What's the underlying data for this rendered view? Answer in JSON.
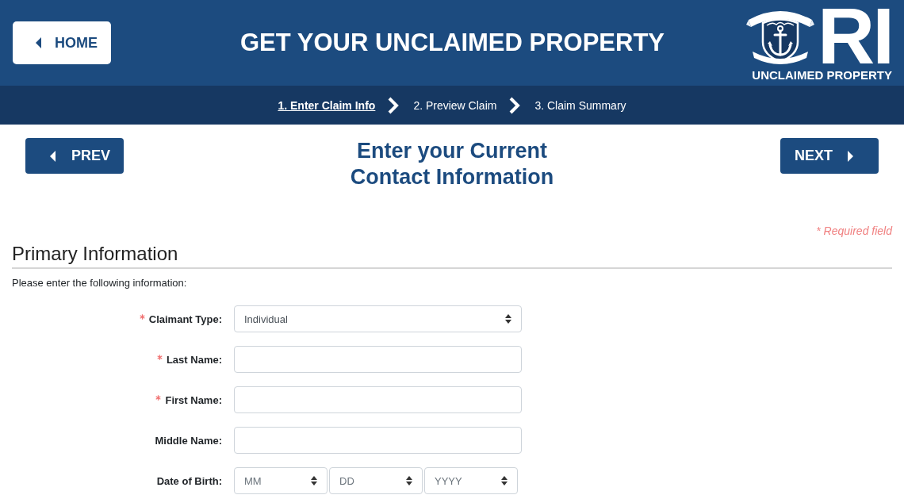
{
  "header": {
    "home_button": "HOME",
    "title": "GET YOUR UNCLAIMED PROPERTY",
    "logo": {
      "wordmark": "RI",
      "caption": "UNCLAIMED PROPERTY"
    }
  },
  "steps": [
    {
      "label": "1. Enter Claim Info",
      "selected": true
    },
    {
      "label": "2. Preview Claim",
      "selected": false
    },
    {
      "label": "3. Claim Summary",
      "selected": false
    }
  ],
  "nav": {
    "prev_button": "PREV",
    "heading": "Enter your Current Contact Information",
    "next_button": "NEXT"
  },
  "required_note": "* Required field",
  "section": {
    "title": "Primary Information",
    "instructions": "Please enter the following information:",
    "fields": [
      {
        "kind": "select",
        "label": "Claimant Type:",
        "required": true,
        "value": "Individual"
      },
      {
        "kind": "text",
        "label": "Last Name:",
        "required": true
      },
      {
        "kind": "text",
        "label": "First Name:",
        "required": true
      },
      {
        "kind": "text",
        "label": "Middle Name:",
        "required": false
      },
      {
        "kind": "date",
        "label": "Date of Birth:",
        "required": false,
        "parts": [
          {
            "placeholder": "MM"
          },
          {
            "placeholder": "DD"
          },
          {
            "placeholder": "YYYY"
          }
        ]
      }
    ]
  }
}
